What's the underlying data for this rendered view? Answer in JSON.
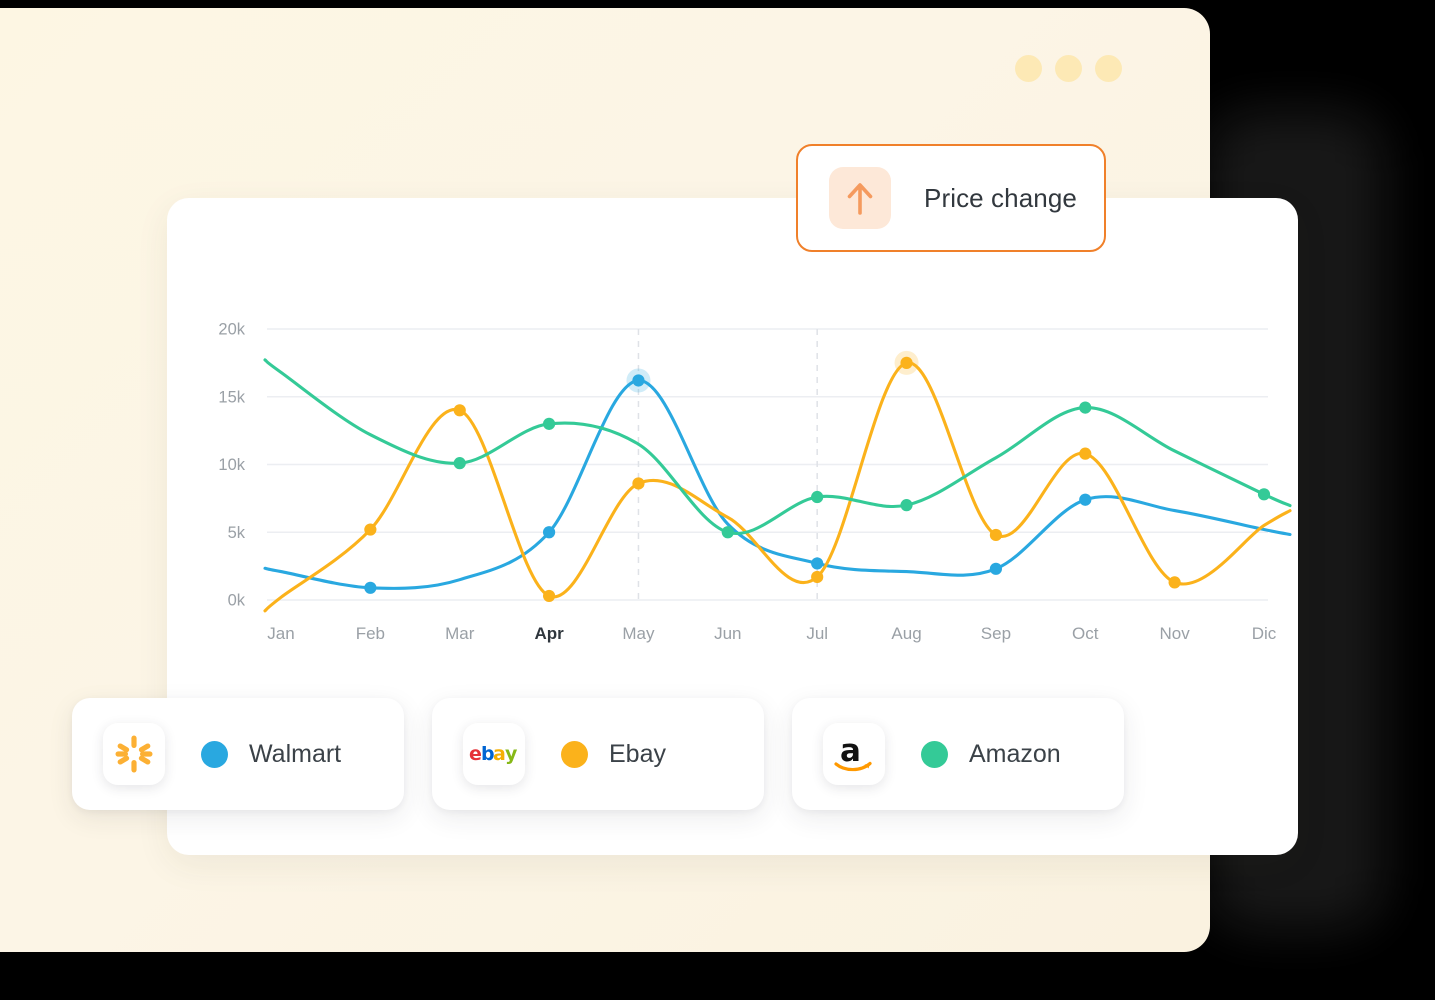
{
  "window": {
    "dots": [
      "window-dot-1",
      "window-dot-2",
      "window-dot-3"
    ],
    "dot_color": "#fde9b5",
    "panel_color": "#fdf6e3"
  },
  "badge": {
    "label": "Price change",
    "icon": "arrow-up-icon",
    "border_color": "#f0802a",
    "icon_bg": "#fde8d8",
    "icon_color": "#f59a5e"
  },
  "legend": {
    "items": [
      {
        "brand": "Walmart",
        "logo": "walmart-spark-logo",
        "color": "#29a8e0"
      },
      {
        "brand": "Ebay",
        "logo": "ebay-logo",
        "color": "#fbb21b"
      },
      {
        "brand": "Amazon",
        "logo": "amazon-logo",
        "color": "#34ca97"
      }
    ]
  },
  "chart_data": {
    "type": "line",
    "title": "",
    "xlabel": "",
    "ylabel": "",
    "categories": [
      "Jan",
      "Feb",
      "Mar",
      "Apr",
      "May",
      "Jun",
      "Jul",
      "Aug",
      "Sep",
      "Oct",
      "Nov",
      "Dic"
    ],
    "active_category": "Apr",
    "highlight_lines": [
      "May",
      "Jul"
    ],
    "ytick_labels": [
      "20k",
      "15k",
      "10k",
      "5k",
      "0k"
    ],
    "ytick_values": [
      20000,
      15000,
      10000,
      5000,
      0
    ],
    "ylim": [
      0,
      20000
    ],
    "grid": true,
    "legend_position": "bottom",
    "series": [
      {
        "name": "Walmart",
        "color": "#29a8e0",
        "values": [
          2100,
          900,
          1500,
          5000,
          16200,
          5600,
          2700,
          2100,
          2300,
          7400,
          6600,
          5200
        ],
        "marker_indices": [
          1,
          3,
          4,
          6,
          8,
          9
        ],
        "highlight_index": 4
      },
      {
        "name": "Ebay",
        "color": "#fbb21b",
        "values": [
          200,
          5200,
          14000,
          300,
          8600,
          6100,
          1700,
          17500,
          4800,
          10800,
          1300,
          5500
        ],
        "marker_indices": [
          1,
          2,
          3,
          4,
          6,
          7,
          8,
          9,
          10
        ],
        "highlight_index": 7
      },
      {
        "name": "Amazon",
        "color": "#34ca97",
        "values": [
          16800,
          12200,
          10100,
          13000,
          11500,
          5000,
          7600,
          7000,
          10500,
          14200,
          11000,
          7800
        ],
        "marker_indices": [
          2,
          3,
          5,
          6,
          7,
          9,
          11
        ]
      }
    ]
  }
}
